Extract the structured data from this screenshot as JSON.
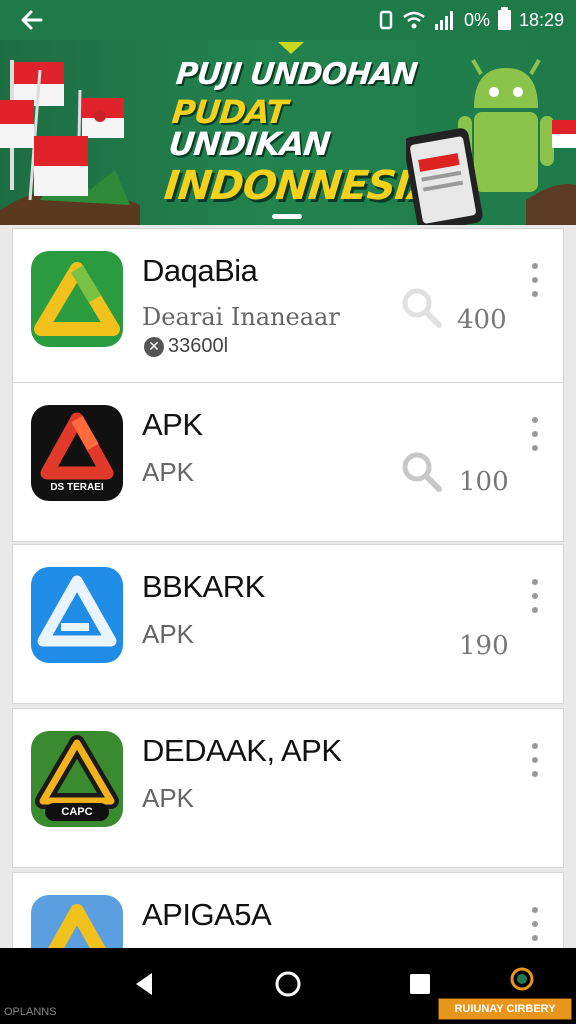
{
  "status_bar": {
    "battery_text": "0%",
    "time": "18:29",
    "icons": [
      "back-arrow-icon",
      "vibrate-icon",
      "wifi-icon",
      "signal-icon",
      "battery-icon"
    ]
  },
  "banner": {
    "line1": "PUJI UNDOHAN",
    "line2_a": "PUDAT",
    "line2_b": "UNDIKAN",
    "line3": "INDONNESIA",
    "colors": {
      "background": "#1f7a4a",
      "accent": "#f4d11a"
    }
  },
  "apps": [
    {
      "name": "DaqaBia",
      "subtitle": "Dearai Inaneaar",
      "meta": "33600l",
      "count": "400",
      "icon": "green-triangle-icon"
    },
    {
      "name": "APK",
      "subtitle": "APK",
      "icon_caption": "DS TERAEI",
      "count": "100",
      "icon": "red-triangle-icon"
    },
    {
      "name": "BBKARK",
      "subtitle": "APK",
      "count": "190",
      "icon": "blue-triangle-icon"
    },
    {
      "name": "DEDAAK, APK",
      "subtitle": "APK",
      "icon_caption": "CAPC",
      "icon": "dark-triangle-icon"
    },
    {
      "name": "APIGA5A",
      "icon": "yellow-triangle-icon"
    }
  ],
  "nav": [
    "back-icon",
    "home-icon",
    "recents-icon",
    "assistant-icon"
  ],
  "watermarks": {
    "left": "OPLANNS",
    "right": "RUIUNAY CIRBERY"
  }
}
